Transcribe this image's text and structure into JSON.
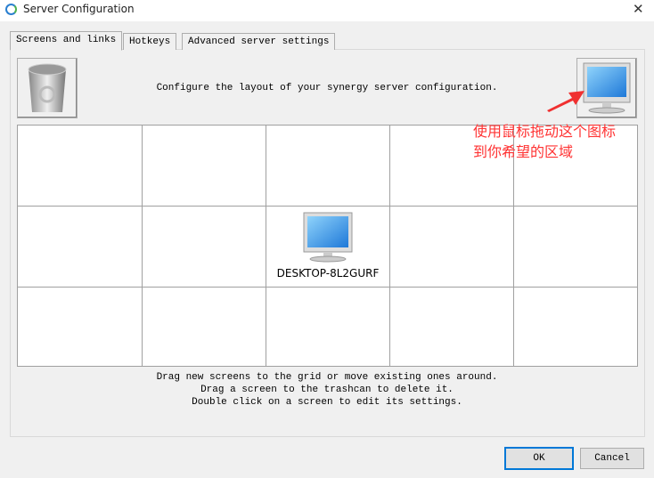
{
  "window": {
    "title": "Server Configuration",
    "close_icon": "close-icon"
  },
  "tabs": [
    {
      "label": "Screens and links",
      "active": true
    },
    {
      "label": "Hotkeys"
    },
    {
      "label": "Advanced server settings"
    }
  ],
  "main": {
    "instruction": "Configure the layout of your synergy server configuration.",
    "annotation_line1": "使用鼠标拖动这个图标",
    "annotation_line2": "到你希望的区域",
    "annotation_color": "#ff3333",
    "grid": {
      "columns": 5,
      "rows": 3,
      "screens": [
        {
          "name": "DESKTOP-8L2GURF",
          "row": 1,
          "col": 2
        }
      ]
    },
    "help": [
      "Drag new screens to the grid or move existing ones around.",
      "Drag a screen to the trashcan to delete it.",
      "Double click on a screen to edit its settings."
    ]
  },
  "buttons": {
    "ok": "OK",
    "cancel": "Cancel"
  }
}
